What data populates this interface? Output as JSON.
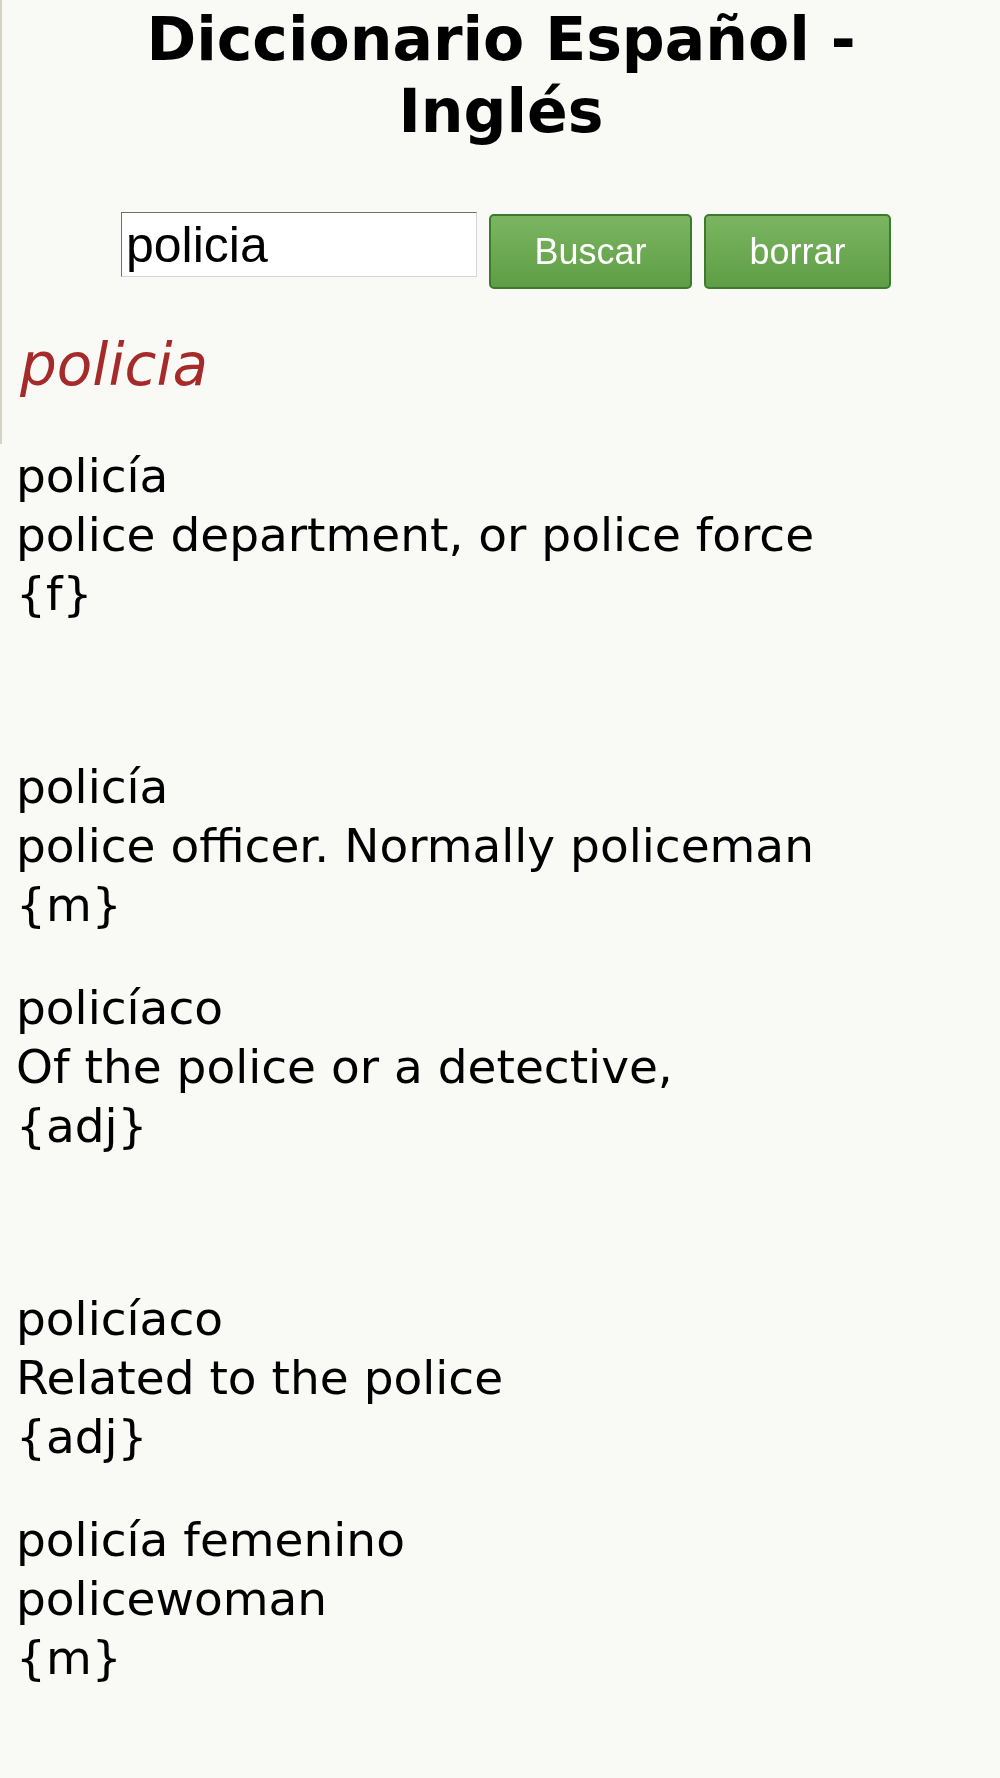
{
  "title": "Diccionario Español - Inglés",
  "search": {
    "value": "policia"
  },
  "buttons": {
    "search": "Buscar",
    "clear": "borrar"
  },
  "query_heading": "policia",
  "results": [
    {
      "headword": "policía",
      "translation": "police department, or police force",
      "grammar": "{f}"
    },
    {
      "headword": "policía",
      "translation": "police officer. Normally policeman",
      "grammar": "{m}"
    },
    {
      "headword": "policíaco",
      "translation": "Of the police or a detective,",
      "grammar": "{adj}"
    },
    {
      "headword": "policíaco",
      "translation": "Related to the police",
      "grammar": "{adj}"
    },
    {
      "headword": "policía femenino",
      "translation": "policewoman",
      "grammar": "{m}"
    }
  ]
}
